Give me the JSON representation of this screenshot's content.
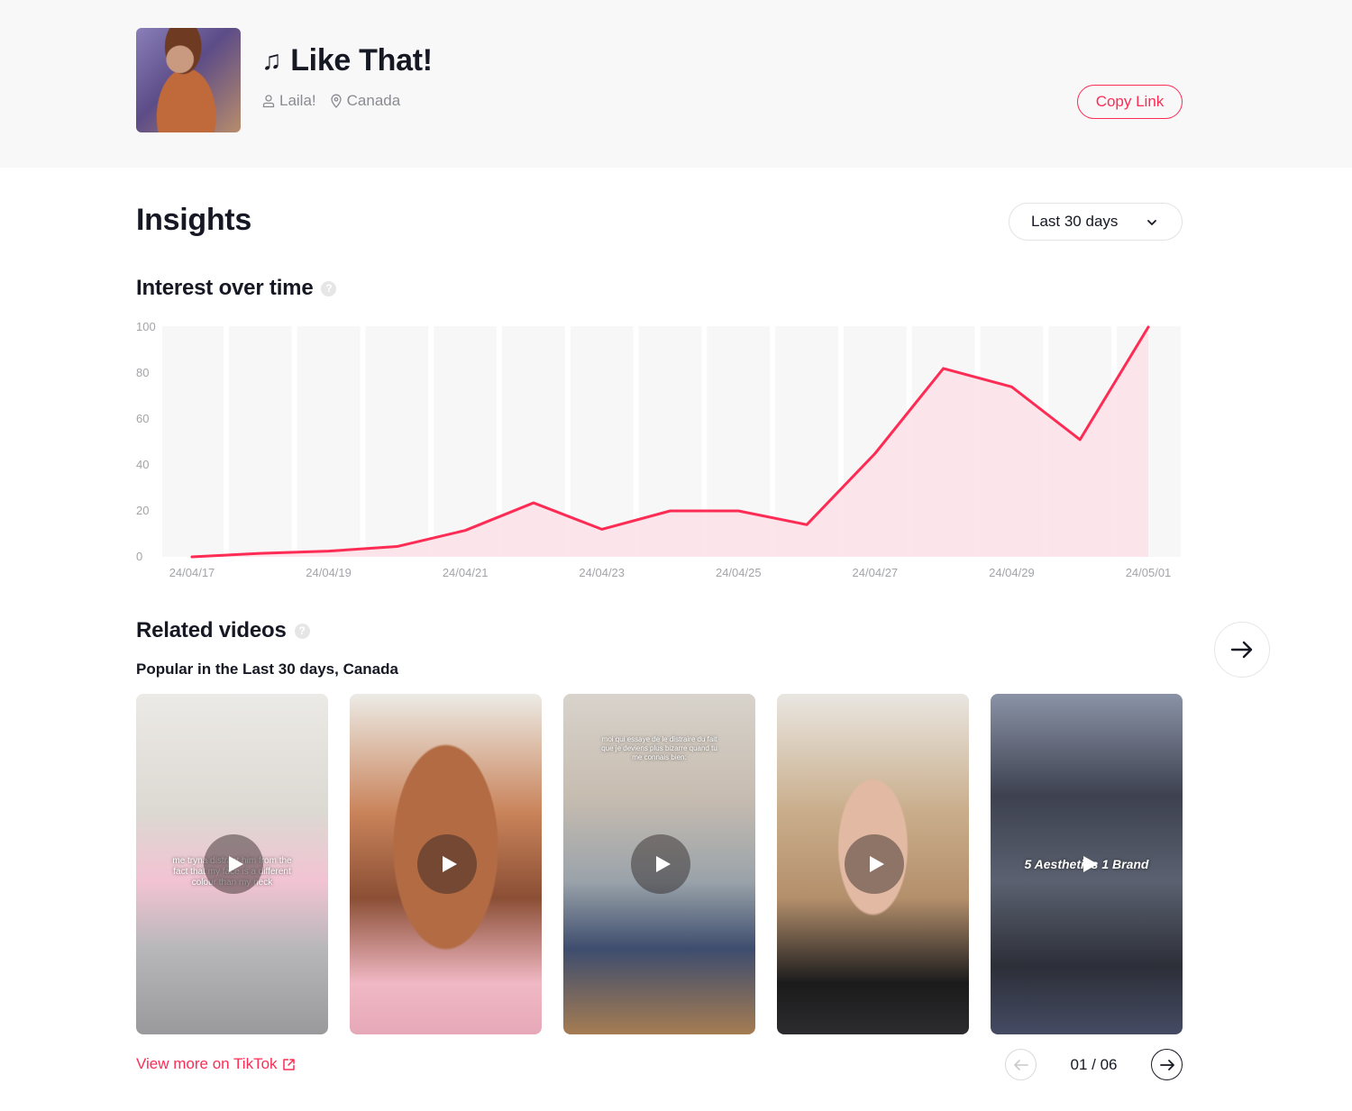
{
  "header": {
    "song_note_icon": "music-note-icon",
    "song_title": "Like That!",
    "artist": "Laila!",
    "artist_icon": "user-icon",
    "region": "Canada",
    "region_icon": "location-pin-icon",
    "copy_link_label": "Copy Link"
  },
  "insights": {
    "title": "Insights",
    "range_selected": "Last 30 days"
  },
  "interest": {
    "title": "Interest over time"
  },
  "related": {
    "title": "Related videos",
    "subtitle": "Popular in the Last 30 days, Canada",
    "videos": [
      {
        "overlay_text": "me tryna distract him from the fact that my face is a different colour than my neck"
      },
      {
        "overlay_text": ""
      },
      {
        "overlay_text": "moi qui essaye de le distraire du fait que je deviens plus bizarre quand tu me connais bien:"
      },
      {
        "overlay_text": ""
      },
      {
        "overlay_text": "5 Aesthetics 1 Brand"
      }
    ],
    "view_more_label": "View more on TikTok",
    "pager_text": "01 / 06",
    "current_page": 1,
    "total_pages": 6
  },
  "colors": {
    "accent": "#fe2c55",
    "area_fill": "#fce1e7",
    "column_bg": "#f7f7f7"
  },
  "chart_data": {
    "type": "area",
    "title": "Interest over time",
    "xlabel": "",
    "ylabel": "",
    "x": [
      "24/04/17",
      "24/04/18",
      "24/04/19",
      "24/04/20",
      "24/04/21",
      "24/04/22",
      "24/04/23",
      "24/04/24",
      "24/04/25",
      "24/04/26",
      "24/04/27",
      "24/04/28",
      "24/04/29",
      "24/04/30",
      "24/05/01"
    ],
    "series": [
      {
        "name": "Interest",
        "values": [
          0,
          1.5,
          2.5,
          4.5,
          11.5,
          23.5,
          12,
          20,
          20,
          14,
          45,
          82,
          74,
          51,
          100
        ]
      }
    ],
    "x_tick_labels": [
      "24/04/17",
      "24/04/19",
      "24/04/21",
      "24/04/23",
      "24/04/25",
      "24/04/27",
      "24/04/29",
      "24/05/01"
    ],
    "y_ticks": [
      0,
      20,
      40,
      60,
      80,
      100
    ],
    "ylim": [
      0,
      100
    ],
    "grid": false,
    "legend": "none"
  }
}
